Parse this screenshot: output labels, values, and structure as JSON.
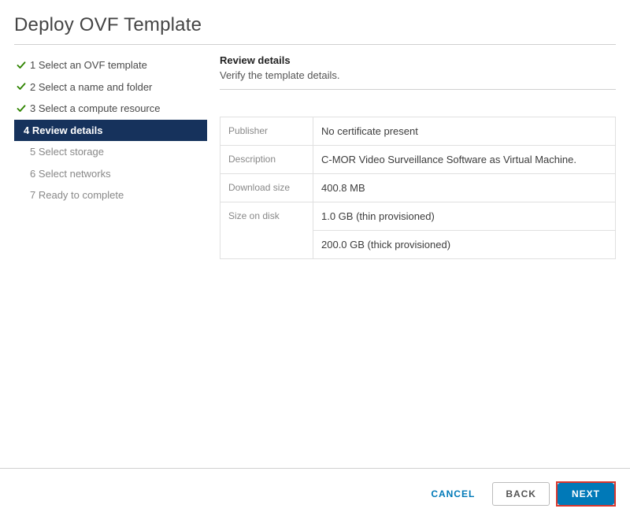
{
  "dialog": {
    "title": "Deploy OVF Template"
  },
  "sidebar": {
    "steps": [
      {
        "label": "1 Select an OVF template",
        "state": "completed"
      },
      {
        "label": "2 Select a name and folder",
        "state": "completed"
      },
      {
        "label": "3 Select a compute resource",
        "state": "completed"
      },
      {
        "label": "4 Review details",
        "state": "active"
      },
      {
        "label": "5 Select storage",
        "state": "pending"
      },
      {
        "label": "6 Select networks",
        "state": "pending"
      },
      {
        "label": "7 Ready to complete",
        "state": "pending"
      }
    ]
  },
  "main": {
    "heading": "Review details",
    "subheading": "Verify the template details.",
    "rows": {
      "publisher_key": "Publisher",
      "publisher_val": "No certificate present",
      "description_key": "Description",
      "description_val": "C-MOR Video Surveillance Software as Virtual Machine.",
      "download_key": "Download size",
      "download_val": "400.8 MB",
      "sizedisk_key": "Size on disk",
      "sizedisk_val1": "1.0 GB (thin provisioned)",
      "sizedisk_val2": "200.0 GB (thick provisioned)"
    }
  },
  "footer": {
    "cancel": "CANCEL",
    "back": "BACK",
    "next": "NEXT"
  },
  "colors": {
    "accent": "#0079b8",
    "active_step_bg": "#16325c",
    "highlight_border": "#d9362d",
    "check_green": "#2f8400"
  }
}
